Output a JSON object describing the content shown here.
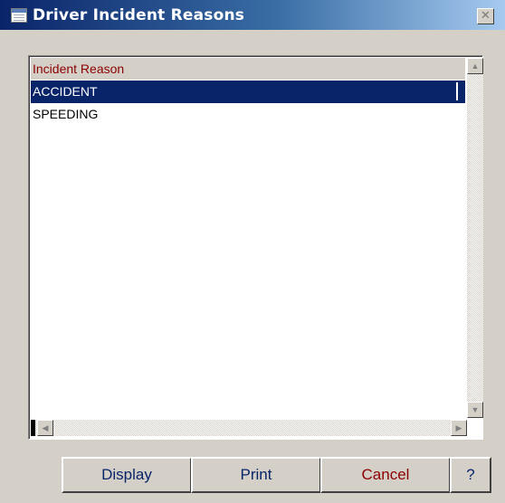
{
  "window": {
    "title": "Driver Incident Reasons",
    "close_glyph": "✕"
  },
  "grid": {
    "columns": [
      "Incident Reason"
    ],
    "rows": [
      {
        "reason": "ACCIDENT",
        "selected": true
      },
      {
        "reason": "SPEEDING",
        "selected": false
      }
    ]
  },
  "buttons": {
    "display": "Display",
    "print": "Print",
    "cancel": "Cancel",
    "help": "?"
  },
  "icons": {
    "title": "grid-table-icon",
    "scroll_up": "triangle-up-icon",
    "scroll_down": "triangle-down-icon",
    "scroll_left": "triangle-left-icon",
    "scroll_right": "triangle-right-icon"
  },
  "colors": {
    "title_start": "#0a246a",
    "title_end": "#a6caf0",
    "selection": "#0a246a",
    "header_text": "#8b0000",
    "button_text": "#0a246a",
    "cancel_text": "#8b0000",
    "face": "#d4d0c8"
  }
}
